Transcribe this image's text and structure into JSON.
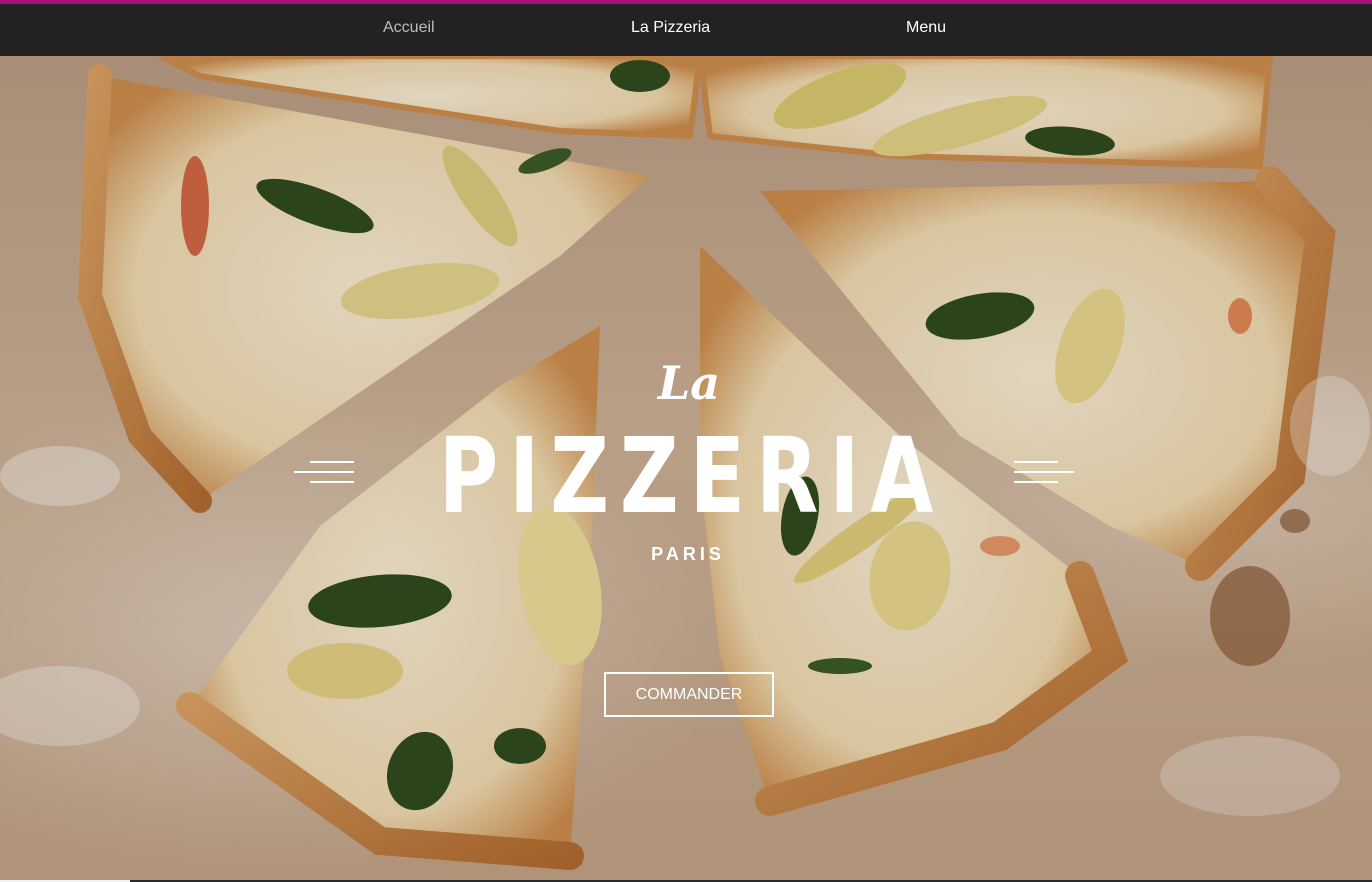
{
  "colors": {
    "accent": "#a3137b",
    "navbar_bg": "#222222",
    "nav_active_text": "#bdbdbd",
    "nav_text": "#ffffff",
    "hero_text": "#ffffff"
  },
  "nav": {
    "items": [
      {
        "label": "Accueil",
        "active": true
      },
      {
        "label": "La Pizzeria",
        "active": false
      },
      {
        "label": "Menu",
        "active": false
      }
    ]
  },
  "hero": {
    "background": "pizza-slices-photo",
    "brand_prefix": "La",
    "brand_title": "PIZZERIA",
    "brand_city": "PARIS",
    "cta_label": "COMMANDER"
  }
}
